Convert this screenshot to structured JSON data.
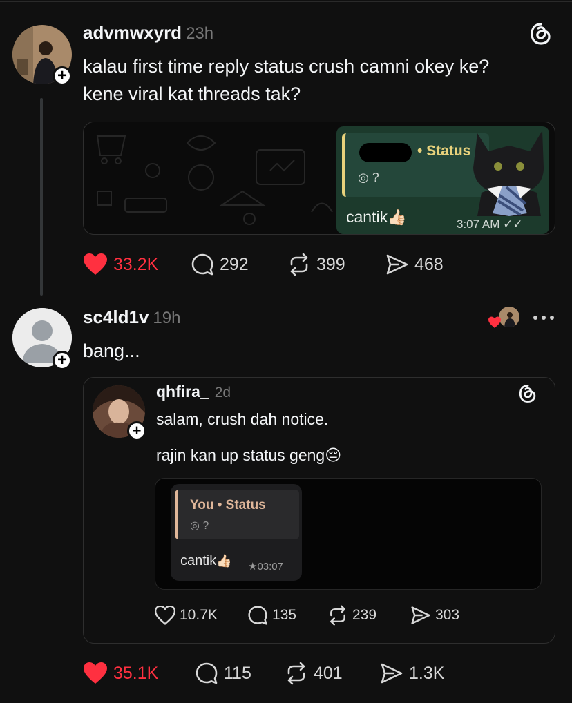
{
  "post1": {
    "username": "advmwxyrd",
    "time": "23h",
    "text_line1": "kalau first time reply status crush camni okey ke?",
    "text_line2": "kene viral kat threads tak?",
    "media": {
      "status_label": "• Status",
      "quote_sub": "?",
      "message": "cantik",
      "emoji": "👍🏻",
      "timestamp": "3:07 AM"
    },
    "actions": {
      "likes": "33.2K",
      "comments": "292",
      "reposts": "399",
      "shares": "468"
    }
  },
  "post2": {
    "username": "sc4ld1v",
    "time": "19h",
    "text": "bang...",
    "quoted": {
      "username": "qhfira_",
      "time": "2d",
      "line1": "salam, crush dah notice.",
      "line2": "rajin kan up status geng",
      "line2_emoji": "😔",
      "media": {
        "header": "You • Status",
        "quote_sub": "?",
        "message": "cantik",
        "emoji": "👍🏻",
        "timestamp": "★03:07"
      },
      "actions": {
        "likes": "10.7K",
        "comments": "135",
        "reposts": "239",
        "shares": "303"
      }
    },
    "actions": {
      "likes": "35.1K",
      "comments": "115",
      "reposts": "401",
      "shares": "1.3K"
    }
  },
  "colors": {
    "like_red": "#ff3040",
    "bg": "#101010",
    "whatsapp_green": "#1c3a2c"
  },
  "icons": [
    "threads-logo-icon",
    "heart-icon",
    "comment-icon",
    "repost-icon",
    "share-icon",
    "more-icon",
    "plus-icon"
  ]
}
